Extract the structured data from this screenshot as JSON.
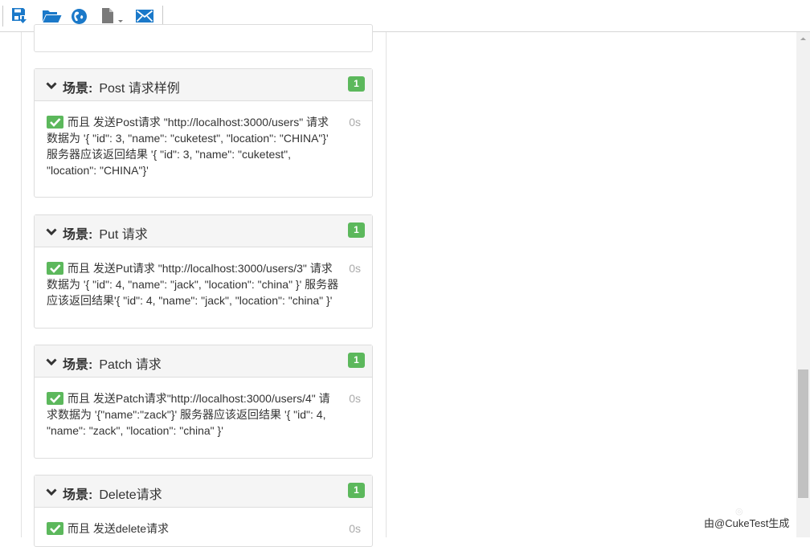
{
  "toolbar": {
    "icons": [
      "save-icon",
      "open-folder-icon",
      "globe-icon",
      "document-dropdown-icon",
      "mail-icon"
    ]
  },
  "colors": {
    "toolbar_icon": "#1b79c9",
    "passed": "#5cb85c",
    "heading_bg": "#f5f5f5",
    "border": "#dddddd",
    "duration": "#aaaaaa"
  },
  "scenarios": [
    {
      "keyword": "场景:",
      "name": "Post 请求样例",
      "count": "1",
      "step": {
        "keyword": "而且",
        "text": "发送Post请求 \"http://localhost:3000/users\" 请求数据为 '{ \"id\": 3, \"name\": \"cuketest\", \"location\": \"CHINA\"}' 服务器应该返回结果 '{ \"id\": 3, \"name\": \"cuketest\", \"location\": \"CHINA\"}'",
        "duration": "0s"
      }
    },
    {
      "keyword": "场景:",
      "name": "Put 请求",
      "count": "1",
      "step": {
        "keyword": "而且",
        "text": "发送Put请求 \"http://localhost:3000/users/3\" 请求数据为 '{ \"id\": 4, \"name\": \"jack\", \"location\": \"china\" }' 服务器应该返回结果'{ \"id\": 4, \"name\": \"jack\", \"location\": \"china\" }'",
        "duration": "0s"
      }
    },
    {
      "keyword": "场景:",
      "name": "Patch 请求",
      "count": "1",
      "step": {
        "keyword": "而且",
        "text": "发送Patch请求\"http://localhost:3000/users/4\" 请求数据为 '{\"name\":\"zack\"}' 服务器应该返回结果 '{ \"id\": 4, \"name\": \"zack\", \"location\": \"china\" }'",
        "duration": "0s"
      }
    },
    {
      "keyword": "场景:",
      "name": "Delete请求",
      "count": "1",
      "step": {
        "keyword": "而且",
        "text": "发送delete请求",
        "duration": "0s"
      }
    }
  ],
  "footer": {
    "generated_by": "由@CukeTest生成"
  }
}
